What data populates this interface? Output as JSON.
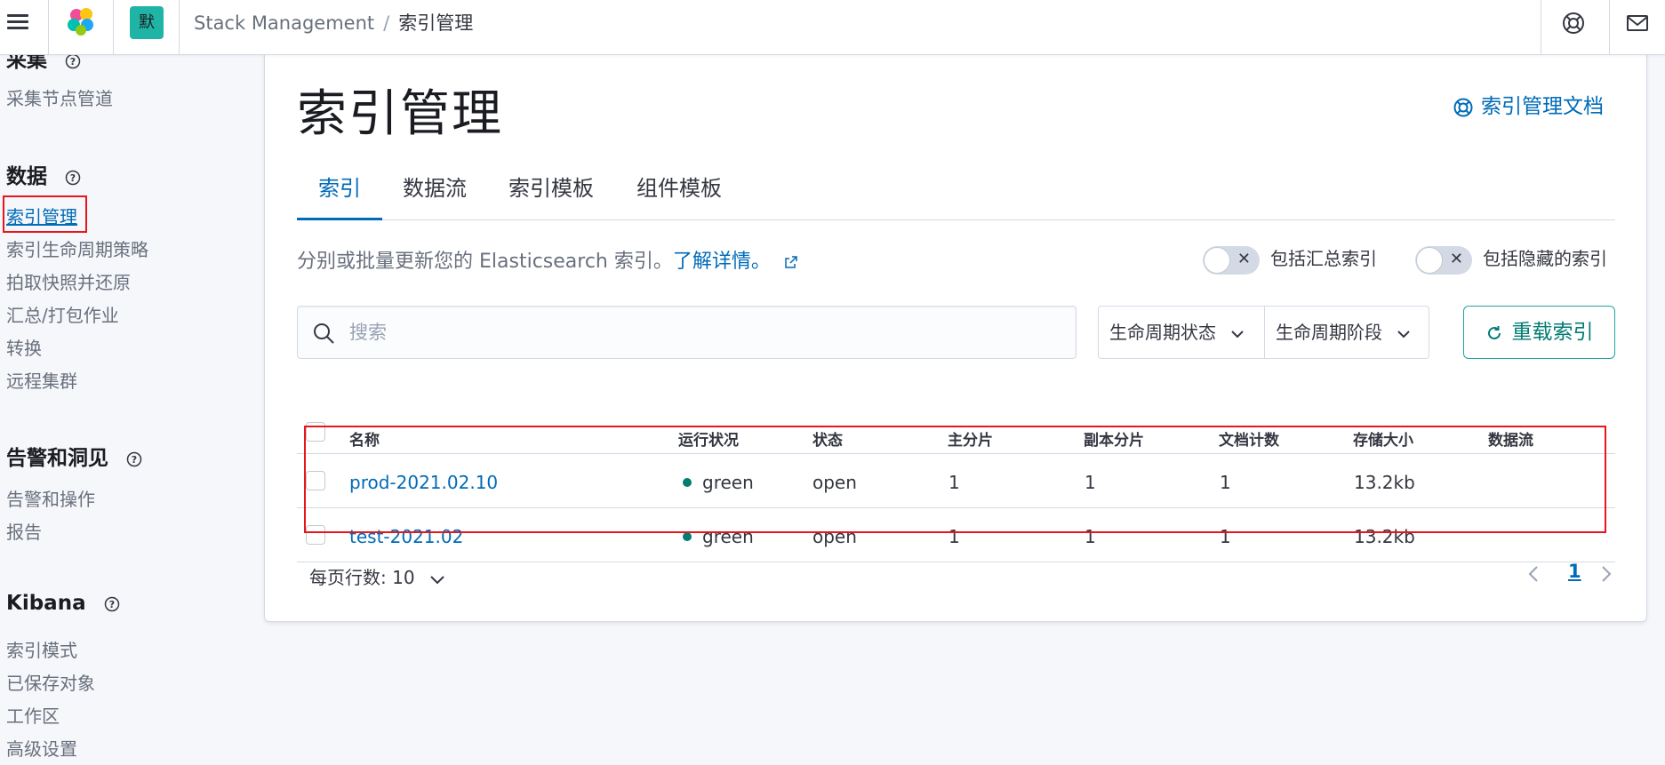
{
  "header": {
    "space_initial": "默",
    "breadcrumbs": [
      "Stack Management",
      "索引管理"
    ],
    "icons": [
      "menu-icon",
      "elastic-logo",
      "help-icon",
      "mail-icon"
    ]
  },
  "sidebar": {
    "sections": [
      {
        "title": "采集",
        "items": [
          "采集节点管道"
        ]
      },
      {
        "title": "数据",
        "items": [
          "索引管理",
          "索引生命周期策略",
          "拍取快照并还原",
          "汇总/打包作业",
          "转换",
          "远程集群"
        ]
      },
      {
        "title": "告警和洞见",
        "items": [
          "告警和操作",
          "报告"
        ]
      },
      {
        "title": "Kibana",
        "items": [
          "索引模式",
          "已保存对象",
          "工作区",
          "高级设置"
        ]
      }
    ],
    "active_item": "索引管理"
  },
  "main": {
    "title": "索引管理",
    "docs_link": "索引管理文档",
    "tabs": [
      "索引",
      "数据流",
      "索引模板",
      "组件模板"
    ],
    "active_tab": "索引",
    "description": "分别或批量更新您的 Elasticsearch 索引。",
    "learn_more": "了解详情。",
    "toggles": [
      {
        "label": "包括汇总索引",
        "on": false
      },
      {
        "label": "包括隐藏的索引",
        "on": false
      }
    ],
    "search": {
      "placeholder": "搜索",
      "value": ""
    },
    "filters": [
      "生命周期状态",
      "生命周期阶段"
    ],
    "reload_button": "重载索引",
    "table": {
      "columns": [
        "名称",
        "运行状况",
        "状态",
        "主分片",
        "副本分片",
        "文档计数",
        "存储大小",
        "数据流"
      ],
      "rows": [
        {
          "name": "prod-2021.02.10",
          "health": "green",
          "status": "open",
          "primary": "1",
          "replicas": "1",
          "docs": "1",
          "size": "13.2kb",
          "data_stream": ""
        },
        {
          "name": "test-2021.02",
          "health": "green",
          "status": "open",
          "primary": "1",
          "replicas": "1",
          "docs": "1",
          "size": "13.2kb",
          "data_stream": ""
        }
      ]
    },
    "rows_per_page": "每页行数: 10",
    "current_page": "1"
  },
  "colors": {
    "link": "#006bb8",
    "success": "#017d73",
    "highlight_box": "#e7161d",
    "space_badge": "#20b4a6"
  }
}
